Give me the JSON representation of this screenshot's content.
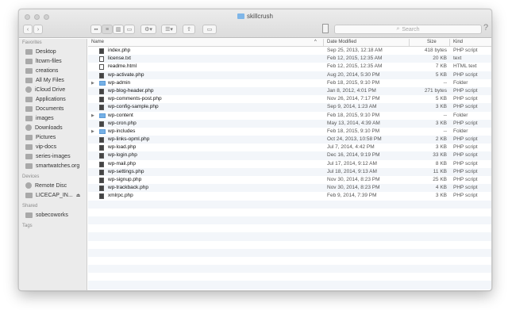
{
  "window": {
    "title": "skillcrush"
  },
  "toolbar": {
    "back_icon": "chevron-left-icon",
    "forward_icon": "chevron-right-icon",
    "search_placeholder": "Search",
    "help_label": "?"
  },
  "sidebar": {
    "sections": [
      {
        "label": "Favorites",
        "items": [
          {
            "label": "Desktop",
            "icon": "desktop-icon"
          },
          {
            "label": "ltcwm-files",
            "icon": "folder-icon"
          },
          {
            "label": "creations",
            "icon": "folder-icon"
          },
          {
            "label": "All My Files",
            "icon": "all-files-icon"
          },
          {
            "label": "iCloud Drive",
            "icon": "cloud-icon"
          },
          {
            "label": "Applications",
            "icon": "applications-icon"
          },
          {
            "label": "Documents",
            "icon": "documents-icon"
          },
          {
            "label": "images",
            "icon": "folder-icon"
          },
          {
            "label": "Downloads",
            "icon": "downloads-icon"
          },
          {
            "label": "Pictures",
            "icon": "pictures-icon"
          },
          {
            "label": "vip-docs",
            "icon": "folder-icon"
          },
          {
            "label": "series-images",
            "icon": "folder-icon"
          },
          {
            "label": "smartwatches.org",
            "icon": "folder-icon"
          }
        ]
      },
      {
        "label": "Devices",
        "items": [
          {
            "label": "Remote Disc",
            "icon": "disc-icon"
          },
          {
            "label": "LICECAP_IN...",
            "icon": "drive-icon",
            "eject": "⏏"
          }
        ]
      },
      {
        "label": "Shared",
        "items": [
          {
            "label": "sobecoworks",
            "icon": "computer-icon"
          }
        ]
      },
      {
        "label": "Tags",
        "items": []
      }
    ]
  },
  "list": {
    "columns": {
      "name": "Name",
      "date": "Date Modified",
      "size": "Size",
      "kind": "Kind"
    },
    "files": [
      {
        "name": "index.php",
        "date": "Sep 25, 2013, 12:18 AM",
        "size": "418 bytes",
        "kind": "PHP script",
        "type": "php",
        "expandable": false
      },
      {
        "name": "license.txt",
        "date": "Feb 12, 2015, 12:35 AM",
        "size": "20 KB",
        "kind": "text",
        "type": "txt",
        "expandable": false
      },
      {
        "name": "readme.html",
        "date": "Feb 12, 2015, 12:35 AM",
        "size": "7 KB",
        "kind": "HTML text",
        "type": "html",
        "expandable": false
      },
      {
        "name": "wp-activate.php",
        "date": "Aug 20, 2014, 5:30 PM",
        "size": "5 KB",
        "kind": "PHP script",
        "type": "php",
        "expandable": false
      },
      {
        "name": "wp-admin",
        "date": "Feb 18, 2015, 9:10 PM",
        "size": "--",
        "kind": "Folder",
        "type": "folder",
        "expandable": true
      },
      {
        "name": "wp-blog-header.php",
        "date": "Jan 8, 2012, 4:01 PM",
        "size": "271 bytes",
        "kind": "PHP script",
        "type": "php",
        "expandable": false
      },
      {
        "name": "wp-comments-post.php",
        "date": "Nov 26, 2014, 7:17 PM",
        "size": "5 KB",
        "kind": "PHP script",
        "type": "php",
        "expandable": false
      },
      {
        "name": "wp-config-sample.php",
        "date": "Sep 9, 2014, 1:23 AM",
        "size": "3 KB",
        "kind": "PHP script",
        "type": "php",
        "expandable": false
      },
      {
        "name": "wp-content",
        "date": "Feb 18, 2015, 9:10 PM",
        "size": "--",
        "kind": "Folder",
        "type": "folder",
        "expandable": true
      },
      {
        "name": "wp-cron.php",
        "date": "May 13, 2014, 4:39 AM",
        "size": "3 KB",
        "kind": "PHP script",
        "type": "php",
        "expandable": false
      },
      {
        "name": "wp-includes",
        "date": "Feb 18, 2015, 9:10 PM",
        "size": "--",
        "kind": "Folder",
        "type": "folder",
        "expandable": true
      },
      {
        "name": "wp-links-opml.php",
        "date": "Oct 24, 2013, 10:58 PM",
        "size": "2 KB",
        "kind": "PHP script",
        "type": "php",
        "expandable": false
      },
      {
        "name": "wp-load.php",
        "date": "Jul 7, 2014, 4:42 PM",
        "size": "3 KB",
        "kind": "PHP script",
        "type": "php",
        "expandable": false
      },
      {
        "name": "wp-login.php",
        "date": "Dec 16, 2014, 9:19 PM",
        "size": "33 KB",
        "kind": "PHP script",
        "type": "php",
        "expandable": false
      },
      {
        "name": "wp-mail.php",
        "date": "Jul 17, 2014, 9:12 AM",
        "size": "8 KB",
        "kind": "PHP script",
        "type": "php",
        "expandable": false
      },
      {
        "name": "wp-settings.php",
        "date": "Jul 18, 2014, 9:13 AM",
        "size": "11 KB",
        "kind": "PHP script",
        "type": "php",
        "expandable": false
      },
      {
        "name": "wp-signup.php",
        "date": "Nov 30, 2014, 8:23 PM",
        "size": "25 KB",
        "kind": "PHP script",
        "type": "php",
        "expandable": false
      },
      {
        "name": "wp-trackback.php",
        "date": "Nov 30, 2014, 8:23 PM",
        "size": "4 KB",
        "kind": "PHP script",
        "type": "php",
        "expandable": false
      },
      {
        "name": "xmlrpc.php",
        "date": "Feb 9, 2014, 7:39 PM",
        "size": "3 KB",
        "kind": "PHP script",
        "type": "php",
        "expandable": false
      }
    ],
    "empty_rows": 11
  },
  "colors": {
    "folder": "#74b0e6",
    "sidebar_bg": "#ebebeb",
    "row_stripe": "#f3f6fa"
  }
}
